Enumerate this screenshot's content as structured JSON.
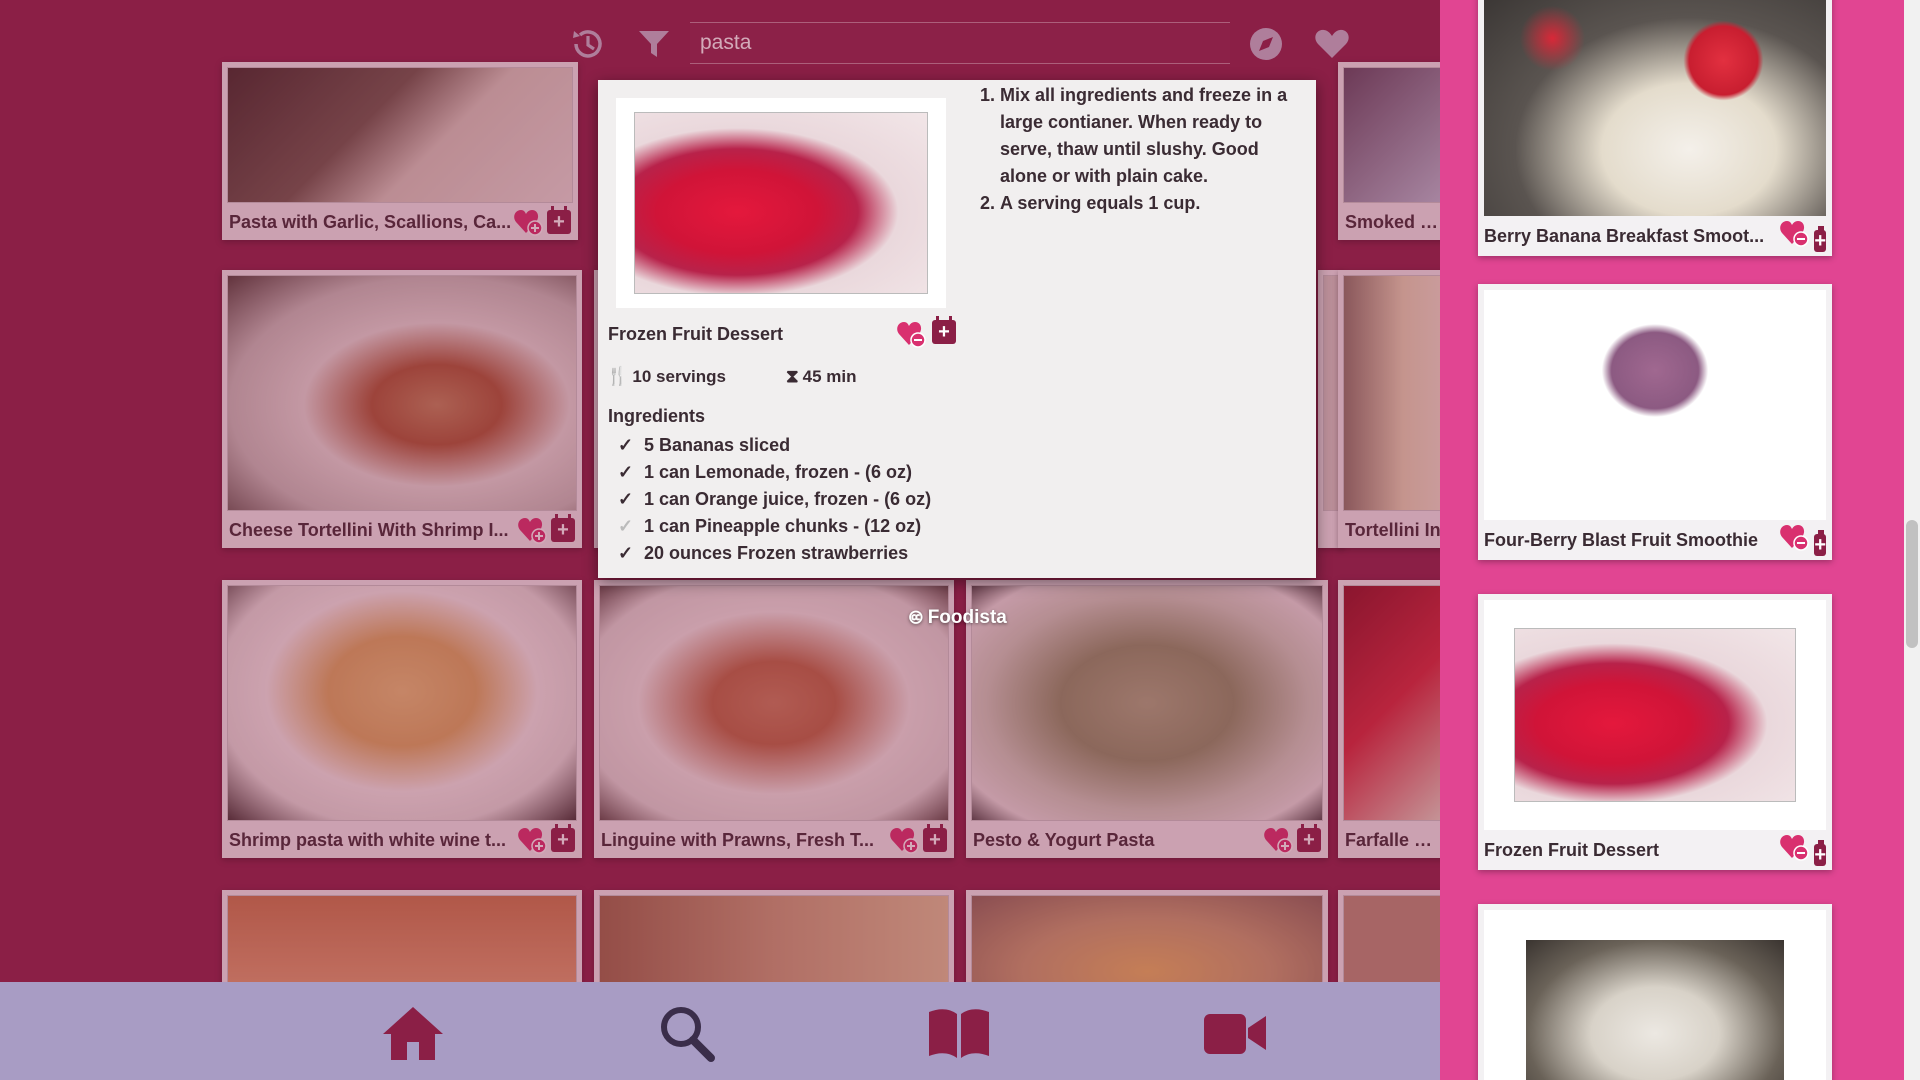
{
  "search": {
    "value": "pasta"
  },
  "topbar": {
    "icons": [
      "history-icon",
      "filter-icon",
      "compass-icon",
      "heart-icon"
    ]
  },
  "grid": {
    "row1": [
      "Pasta with Garlic, Scallions, Ca...",
      "Smoked Sa"
    ],
    "row2": [
      "Cheese Tortellini With Shrimp I...",
      "Tortellini In"
    ],
    "row3": [
      "Shrimp pasta with white wine t...",
      "Linguine with Prawns, Fresh T...",
      "Pesto & Yogurt Pasta",
      "Farfalle with"
    ]
  },
  "popup": {
    "title": "Frozen Fruit Dessert",
    "servings": "10 servings",
    "time": "45 min",
    "ingredients_heading": "Ingredients",
    "ingredients": [
      "5 Bananas sliced",
      "1 can Lemonade, frozen - (6 oz)",
      "1 can Orange juice, frozen - (6 oz)",
      "1 can Pineapple chunks - (12 oz)",
      "20 ounces Frozen strawberries"
    ],
    "steps": [
      "Mix all ingredients and freeze in a large contianer. When ready to serve, thaw until slushy. Good alone or with plain cake.",
      "A serving equals 1 cup."
    ]
  },
  "credit": "Foodista",
  "sidebar": {
    "items": [
      "Berry Banana Breakfast Smoot...",
      "Four-Berry Blast Fruit Smoothie",
      "Frozen Fruit Dessert",
      ""
    ]
  },
  "bottomnav": [
    "home-icon",
    "search-icon",
    "book-icon",
    "video-icon"
  ],
  "colors": {
    "main": "#8b1f46",
    "sidebar": "#e14592",
    "nav": "#a89cc4",
    "accent": "#d9306f"
  }
}
